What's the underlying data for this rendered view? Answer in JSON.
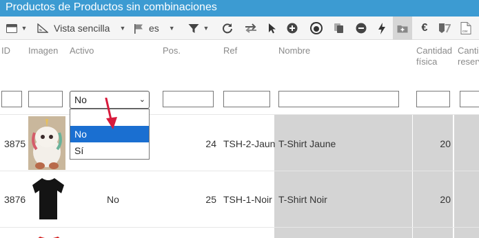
{
  "window": {
    "title": "Productos de Productos sin combinaciones"
  },
  "toolbar": {
    "view_label": "Vista sencilla",
    "lang_label": "es"
  },
  "columns": {
    "id": "ID",
    "image": "Imagen",
    "active": "Activo",
    "pos": "Pos.",
    "ref": "Ref",
    "name": "Nombre",
    "qty_line1": "Cantidad",
    "qty_line2": "física",
    "reserved_line1": "Canti",
    "reserved_line2": "reserv"
  },
  "filters": {
    "active_selected": "No",
    "active_options": [
      "",
      "No",
      "Sí"
    ]
  },
  "rows": [
    {
      "id": "3875",
      "active": "",
      "pos": "24",
      "ref": "TSH-2-Jaun",
      "name": "T-Shirt Jaune",
      "qty": "20",
      "image_icon": "plush-unicorn-image"
    },
    {
      "id": "3876",
      "active": "No",
      "pos": "25",
      "ref": "TSH-1-Noir",
      "name": "T-Shirt Noir",
      "qty": "20",
      "image_icon": "black-tshirt-image"
    },
    {
      "id": "",
      "active": "",
      "pos": "",
      "ref": "",
      "name": "",
      "qty": "",
      "image_icon": "red-tshirt-image"
    }
  ],
  "colors": {
    "title_bg": "#3c9bd2",
    "toolbar_bg": "#f5f5f5",
    "highlight_col": "#d4d4d4",
    "selected_option": "#1a6fd1",
    "arrow": "#d81b3c"
  }
}
